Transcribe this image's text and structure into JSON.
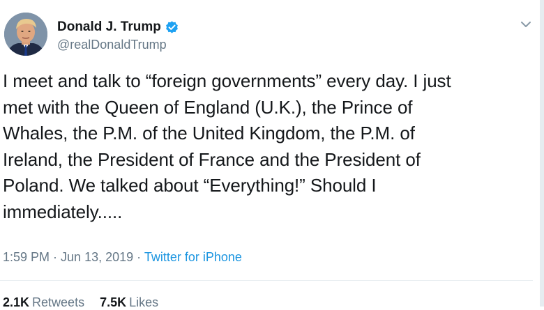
{
  "author": {
    "display_name": "Donald J. Trump",
    "handle": "@realDonaldTrump",
    "verified_icon": "verified-badge-icon",
    "accent_color": "#1da1f2"
  },
  "tweet": {
    "lines": [
      "I meet and talk to “foreign governments” every day. I just",
      "met with the Queen of England (U.K.), the Prince of",
      "Whales, the P.M. of the United Kingdom, the P.M. of",
      "Ireland, the President of France and the President of",
      "Poland. We talked about “Everything!” Should I",
      "immediately....."
    ]
  },
  "meta": {
    "time": "1:59 PM",
    "separator1": " · ",
    "date": "Jun 13, 2019",
    "separator2": " · ",
    "source": "Twitter for iPhone"
  },
  "stats": {
    "retweets_count": "2.1K",
    "retweets_label": "Retweets",
    "likes_count": "7.5K",
    "likes_label": "Likes"
  }
}
